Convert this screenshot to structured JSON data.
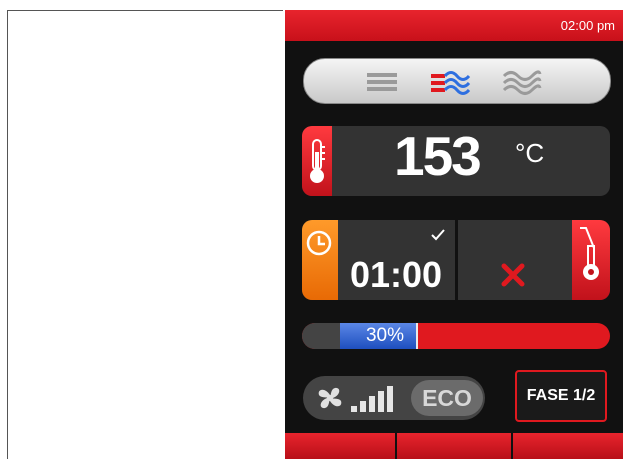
{
  "status_bar": {
    "time": "02:00 pm"
  },
  "cooking_modes": {
    "items": [
      {
        "icon": "convection-lines-icon",
        "selected": false
      },
      {
        "icon": "hot-air-waves-icon",
        "selected": true
      },
      {
        "icon": "steam-waves-icon",
        "selected": false
      }
    ]
  },
  "temperature": {
    "value": "153",
    "unit": "°C",
    "icon": "thermometer-icon"
  },
  "timer": {
    "value": "01:00",
    "confirmed_icon": "check-icon",
    "icon": "clock-icon"
  },
  "probe": {
    "state_icon": "cancel-x-icon",
    "icon": "core-probe-icon"
  },
  "progress": {
    "percent": 30,
    "label": "30%"
  },
  "fan": {
    "icon": "fan-icon",
    "speed_level": 4,
    "speed_max": 5
  },
  "eco": {
    "label": "ECO"
  },
  "phase": {
    "label": "FASE 1/2"
  },
  "colors": {
    "accent_red": "#e0191f",
    "timer_orange": "#f07a10",
    "progress_blue": "#2e5fd0",
    "panel_dark": "#111111"
  }
}
